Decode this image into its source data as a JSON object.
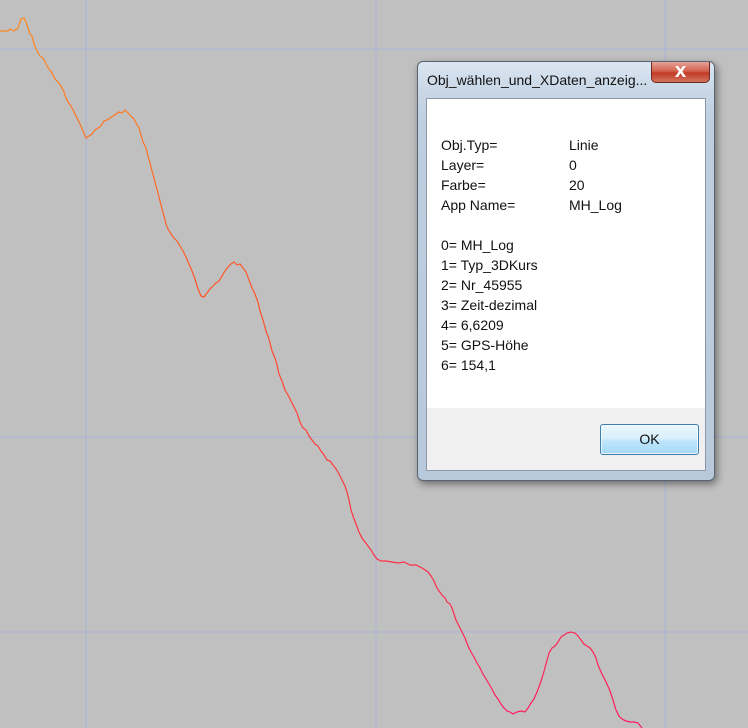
{
  "dialog": {
    "title": "Obj_wählen_und_XDaten_anzeig...",
    "close_label": "X",
    "properties": [
      {
        "key": "Obj.Typ=",
        "value": "Linie"
      },
      {
        "key": "Layer=",
        "value": "0"
      },
      {
        "key": "Farbe=",
        "value": "20"
      },
      {
        "key": "App Name=",
        "value": "MH_Log"
      }
    ],
    "xdata": [
      "0= MH_Log",
      "1= Typ_3DKurs",
      "2= Nr_45955",
      "3= Zeit-dezimal",
      "4= 6,6209",
      "5= GPS-Höhe",
      "6= 154,1"
    ],
    "ok_label": "OK"
  },
  "canvas": {
    "background": "#c0c0c0",
    "grid_color": "#a9b4dc",
    "curve_color_start": "#ff7f2a",
    "curve_color_end": "#ff1f5a"
  }
}
